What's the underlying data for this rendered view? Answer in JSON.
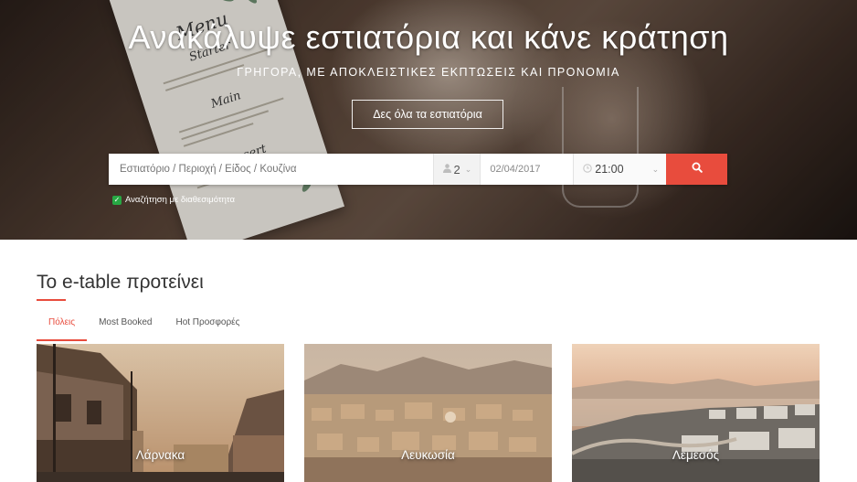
{
  "hero": {
    "title": "Ανακάλυψε εστιατόρια και κάνε κράτηση",
    "subtitle": "ΓΡΗΓΟΡΑ, ΜΕ ΑΠΟΚΛΕΙΣΤΙΚΕΣ ΕΚΠΤΩΣΕΙΣ ΚΑΙ ΠΡΟΝΟΜΙΑ",
    "cta_label": "Δες όλα τα εστιατόρια",
    "menu_card": {
      "title": "Menu",
      "sections": [
        "Starter",
        "Main",
        "Dessert"
      ]
    }
  },
  "search": {
    "placeholder": "Εστιατόριο / Περιοχή / Είδος / Κουζίνα",
    "people": "2",
    "date": "02/04/2017",
    "time": "21:00",
    "availability_label": "Αναζήτηση με διαθεσιμότητα",
    "availability_checked": true
  },
  "section": {
    "title": "Το e-table προτείνει",
    "tabs": [
      {
        "label": "Πόλεις",
        "active": true
      },
      {
        "label": "Most Booked",
        "active": false
      },
      {
        "label": "Hot Προσφορές",
        "active": false
      }
    ]
  },
  "cities": [
    {
      "name": "Λάρνακα"
    },
    {
      "name": "Λευκωσία"
    },
    {
      "name": "Λεμεσός"
    }
  ],
  "colors": {
    "accent": "#e84c3d",
    "check": "#27a844"
  }
}
